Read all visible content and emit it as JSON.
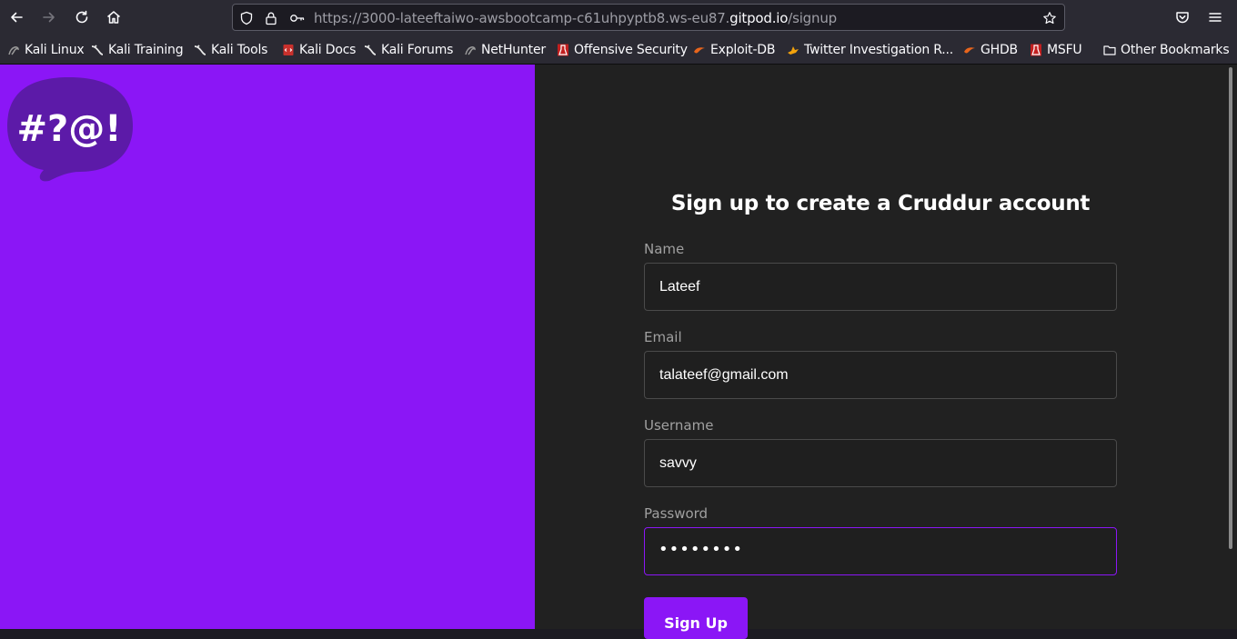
{
  "browser": {
    "url_prefix": "https://3000-lateeftaiwo-awsbootcamp-c61uhpyptb8.ws-eu87.",
    "url_host": "gitpod.io",
    "url_path": "/signup"
  },
  "bookmarks": [
    {
      "label": "Kali Linux",
      "icon": "kali-dragon-icon"
    },
    {
      "label": "Kali Training",
      "icon": "kali-dragon-icon"
    },
    {
      "label": "Kali Tools",
      "icon": "kali-dragon-icon"
    },
    {
      "label": "Kali Docs",
      "icon": "kali-docs-icon"
    },
    {
      "label": "Kali Forums",
      "icon": "kali-dragon-icon"
    },
    {
      "label": "NetHunter",
      "icon": "nethunter-icon"
    },
    {
      "label": "Offensive Security",
      "icon": "offsec-icon"
    },
    {
      "label": "Exploit-DB",
      "icon": "exploit-db-icon"
    },
    {
      "label": "Twitter Investigation R...",
      "icon": "twitter-investigation-icon"
    },
    {
      "label": "GHDB",
      "icon": "ghdb-icon"
    },
    {
      "label": "MSFU",
      "icon": "msfu-icon"
    },
    {
      "label": "Other Bookmarks",
      "icon": "folder-icon"
    }
  ],
  "logo": {
    "text": "#?@!"
  },
  "form": {
    "title": "Sign up to create a Cruddur account",
    "name_label": "Name",
    "name_value": "Lateef",
    "email_label": "Email",
    "email_value": "talateef@gmail.com",
    "username_label": "Username",
    "username_value": "savvy",
    "password_label": "Password",
    "password_mask": "••••••••",
    "submit_label": "Sign Up"
  },
  "colors": {
    "accent": "#8b16f6",
    "left_bg": "#8b16f6",
    "right_bg": "#212121",
    "logo_bubble": "#5c1aa8"
  }
}
